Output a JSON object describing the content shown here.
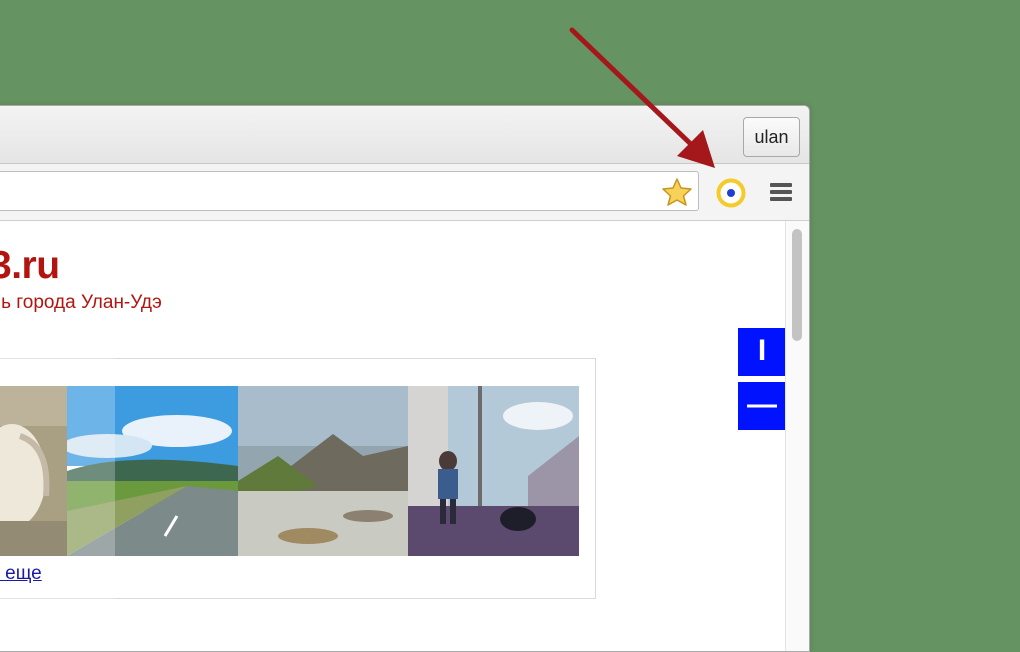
{
  "browser": {
    "profile_name": "ulan",
    "toolbar": {
      "bookmark_icon": "star-icon",
      "extension_icon": "extension-circle-icon",
      "menu_icon": "hamburger-menu-icon",
      "accent": "#f5cb2a"
    }
  },
  "page": {
    "site_title": "3.ru",
    "site_subtitle": "ль города Улан-Удэ",
    "title_color": "#b2150f",
    "gallery": {
      "photos": [
        "goat-photo",
        "road-landscape-photo",
        "mountain-river-photo",
        "child-train-station-photo"
      ],
      "more_link": "ь еще"
    },
    "zoom_controls": {
      "plus_label": "I",
      "minus_label": "—",
      "color": "#0012ff"
    }
  },
  "background_color": "#669362",
  "annotation_arrow_color": "#a4181b"
}
